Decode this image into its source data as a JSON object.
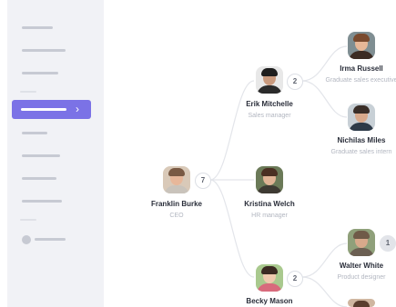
{
  "sidebar": {
    "active_item_chevron": "›",
    "icon_names": [
      "chevron-right-icon"
    ]
  },
  "org_chart": {
    "root": {
      "name": "Franklin Burke",
      "role": "CEO",
      "reports_count": "7"
    },
    "managers": [
      {
        "name": "Erik Mitchelle",
        "role": "Sales manager",
        "reports_count": "2"
      },
      {
        "name": "Kristina Welch",
        "role": "HR manager"
      },
      {
        "name": "Becky Mason",
        "role": "",
        "reports_count": "2"
      }
    ],
    "reports": [
      {
        "name": "Irma Russell",
        "role": "Graduate sales executive"
      },
      {
        "name": "Nichilas Miles",
        "role": "Graduate sales intern"
      },
      {
        "name": "Walter White",
        "role": "Product designer",
        "reports_count": "1"
      }
    ]
  },
  "colors": {
    "accent": "#7b72e6",
    "sidebar_bg": "#f1f2f6",
    "connector": "#e3e5ea",
    "name_text": "#2a2e3a",
    "role_text": "#b2b6c0"
  }
}
